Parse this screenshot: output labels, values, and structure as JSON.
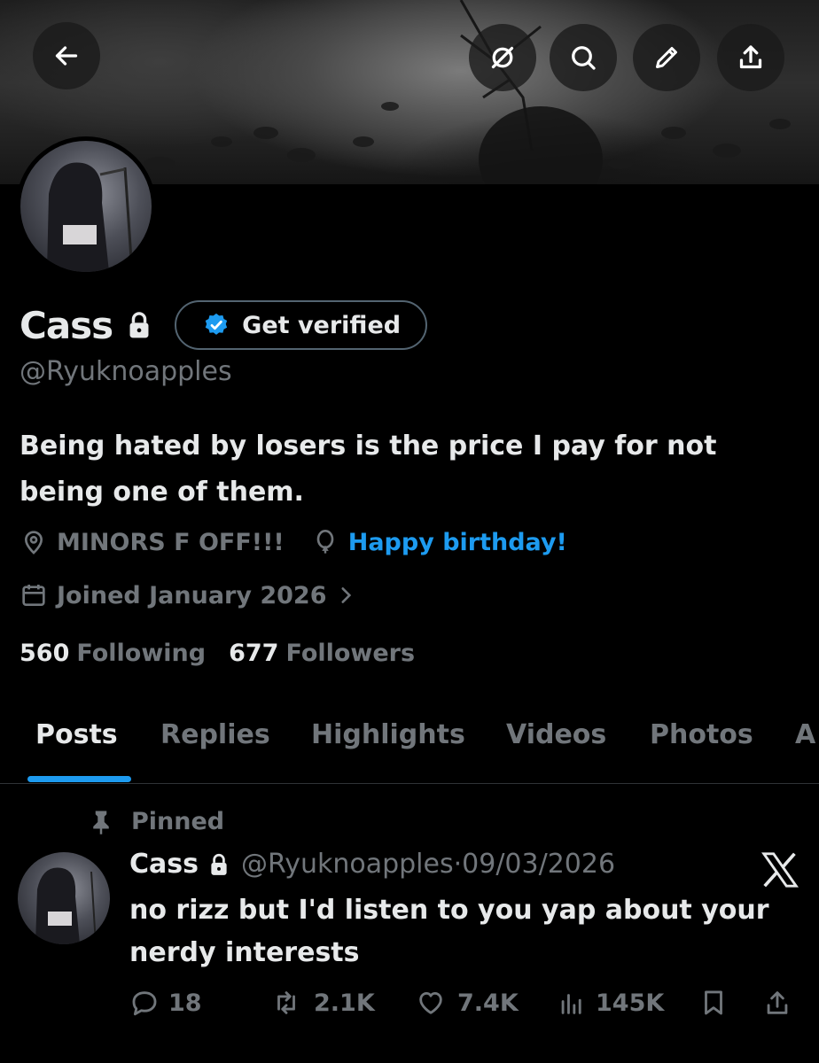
{
  "header": {
    "back_icon": "arrow-left-icon",
    "actions": [
      "grok-icon",
      "search-icon",
      "pencil-icon",
      "share-icon"
    ]
  },
  "profile": {
    "display_name": "Cass",
    "lock_icon": "lock-icon",
    "get_verified_label": "Get verified",
    "handle": "@Ryuknoapples",
    "bio": "Being hated by losers is the price I pay for not being one of them.",
    "location": "MINORS F OFF!!!",
    "birthday": "Happy birthday!",
    "joined": "Joined January 2026",
    "following_count": "560",
    "following_label": "Following",
    "followers_count": "677",
    "followers_label": "Followers"
  },
  "tabs": [
    "Posts",
    "Replies",
    "Highlights",
    "Videos",
    "Photos",
    "A"
  ],
  "active_tab": "Posts",
  "pinned_post": {
    "pinned_label": "Pinned",
    "author_name": "Cass",
    "author_handle": "@Ryuknoapples",
    "separator": "·",
    "date": "09/03/2026",
    "text": "no rizz but I'd listen to you yap about your nerdy interests",
    "replies": "18",
    "reposts": "2.1K",
    "likes": "7.4K",
    "views": "145K"
  },
  "colors": {
    "background": "#000000",
    "text_primary": "#e7e9ea",
    "text_secondary": "#71767b",
    "accent": "#1d9bf0",
    "border": "#2f3336"
  }
}
